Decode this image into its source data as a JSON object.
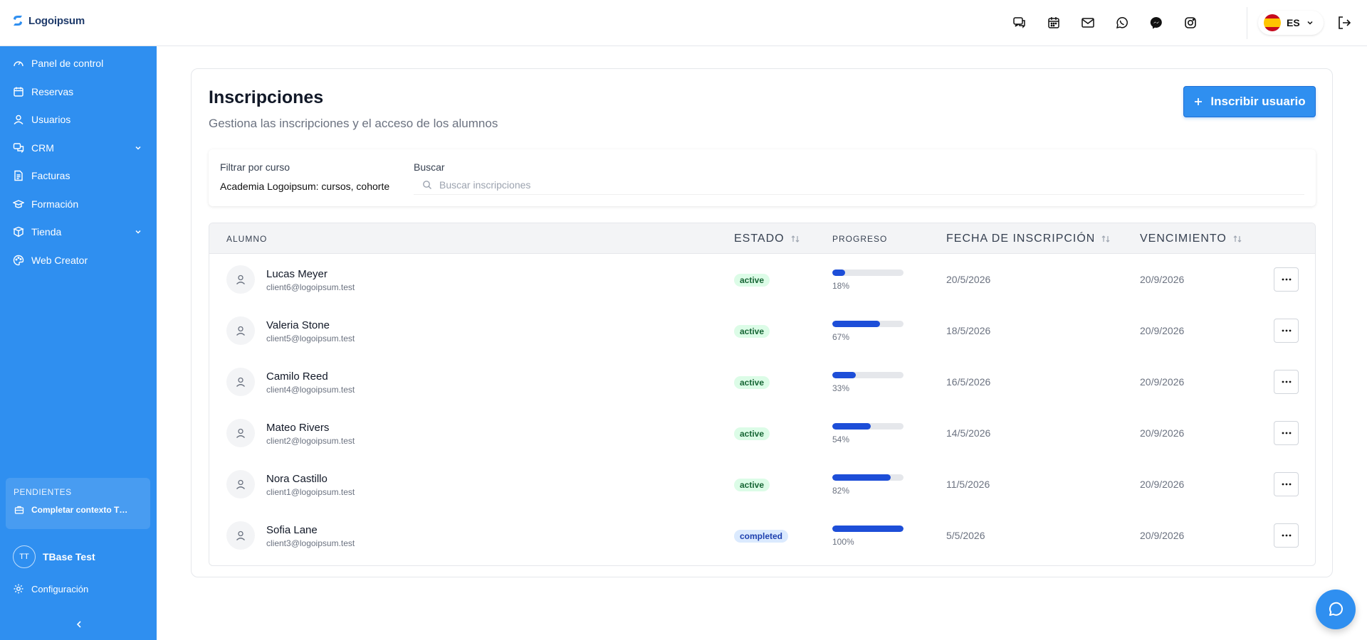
{
  "brand": {
    "name": "Logoipsum"
  },
  "header": {
    "icons": [
      "chat-bubbles-icon",
      "calendar-icon",
      "mail-icon",
      "whatsapp-icon",
      "messenger-icon",
      "instagram-icon"
    ],
    "language": {
      "code": "ES",
      "flag": "spain-flag"
    }
  },
  "sidebar": {
    "items": [
      {
        "label": "Panel de control",
        "icon": "dashboard-icon"
      },
      {
        "label": "Reservas",
        "icon": "calendar-icon"
      },
      {
        "label": "Usuarios",
        "icon": "user-icon"
      },
      {
        "label": "CRM",
        "icon": "crm-icon",
        "expandable": true
      },
      {
        "label": "Facturas",
        "icon": "invoice-icon"
      },
      {
        "label": "Formación",
        "icon": "graduation-cap-icon"
      },
      {
        "label": "Tienda",
        "icon": "store-icon",
        "expandable": true
      },
      {
        "label": "Web Creator",
        "icon": "palette-icon"
      }
    ],
    "pending": {
      "title": "PENDIENTES",
      "item_label": "Completar contexto T…"
    },
    "user": {
      "initials": "TT",
      "name": "TBase Test"
    },
    "config_label": "Configuración"
  },
  "main": {
    "title": "Inscripciones",
    "subtitle": "Gestiona las inscripciones y el acceso de los alumnos",
    "enroll_button": "Inscribir usuario",
    "filter": {
      "course_label": "Filtrar por curso",
      "course_value": "Academia Logoipsum: cursos, cohorte",
      "search_label": "Buscar",
      "search_placeholder": "Buscar inscripciones"
    },
    "table": {
      "headers": {
        "student": "ALUMNO",
        "status": "ESTADO",
        "progress": "PROGRESO",
        "enrolled": "FECHA DE INSCRIPCIÓN",
        "expires": "VENCIMIENTO"
      },
      "rows": [
        {
          "name": "Lucas Meyer",
          "email": "client6@logoipsum.test",
          "status": "active",
          "progress": 18,
          "progress_label": "18%",
          "enrolled": "20/5/2026",
          "expires": "20/9/2026"
        },
        {
          "name": "Valeria Stone",
          "email": "client5@logoipsum.test",
          "status": "active",
          "progress": 67,
          "progress_label": "67%",
          "enrolled": "18/5/2026",
          "expires": "20/9/2026"
        },
        {
          "name": "Camilo Reed",
          "email": "client4@logoipsum.test",
          "status": "active",
          "progress": 33,
          "progress_label": "33%",
          "enrolled": "16/5/2026",
          "expires": "20/9/2026"
        },
        {
          "name": "Mateo Rivers",
          "email": "client2@logoipsum.test",
          "status": "active",
          "progress": 54,
          "progress_label": "54%",
          "enrolled": "14/5/2026",
          "expires": "20/9/2026"
        },
        {
          "name": "Nora Castillo",
          "email": "client1@logoipsum.test",
          "status": "active",
          "progress": 82,
          "progress_label": "82%",
          "enrolled": "11/5/2026",
          "expires": "20/9/2026"
        },
        {
          "name": "Sofia Lane",
          "email": "client3@logoipsum.test",
          "status": "completed",
          "progress": 100,
          "progress_label": "100%",
          "enrolled": "5/5/2026",
          "expires": "20/9/2026"
        }
      ]
    }
  },
  "colors": {
    "accent": "#2f8ff0",
    "progress": "#1d4ed8",
    "active_bg": "#dcfce7",
    "completed_bg": "#dbeafe"
  }
}
